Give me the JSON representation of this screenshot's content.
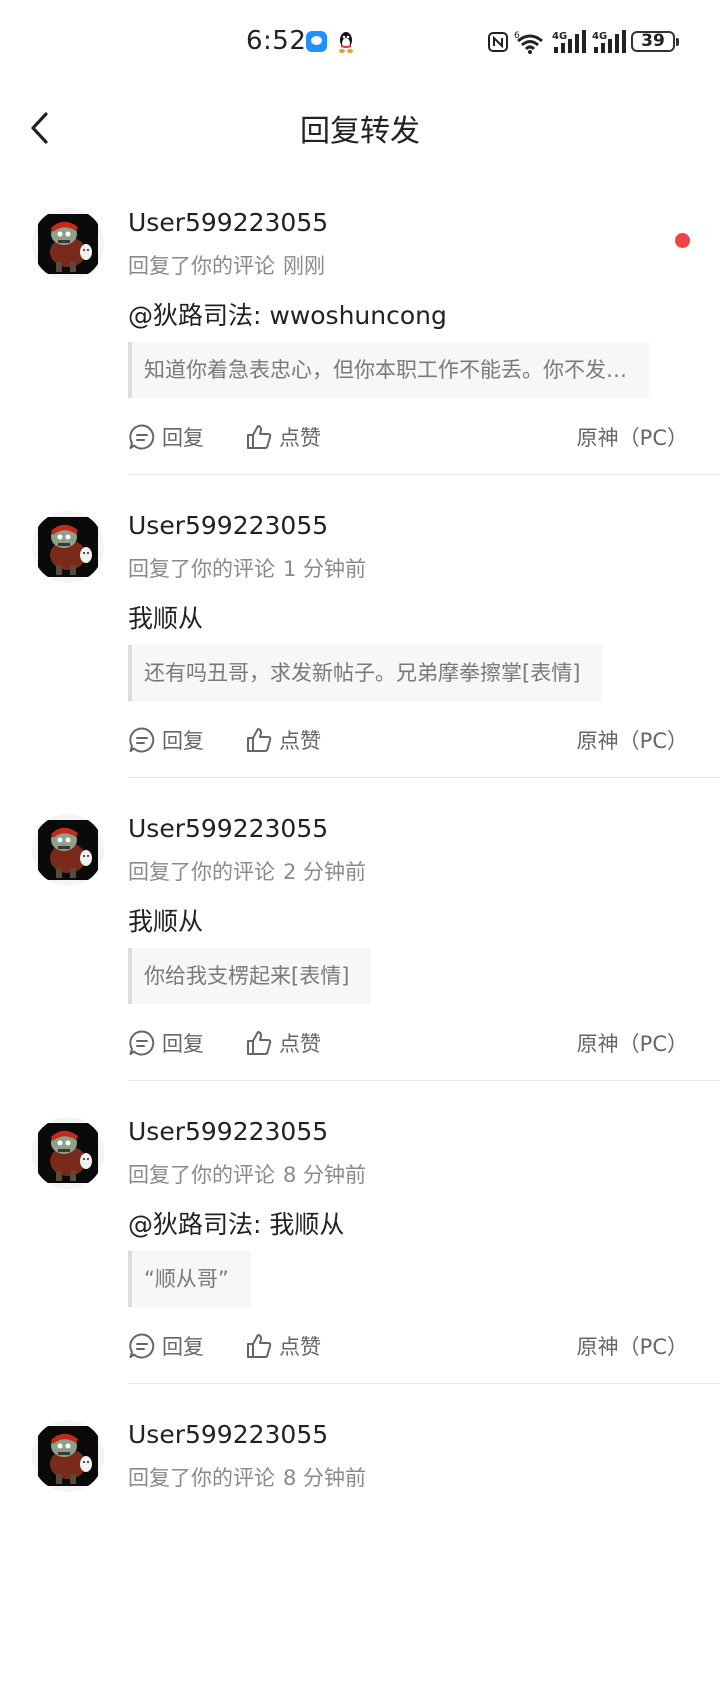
{
  "status_bar": {
    "time": "6:52",
    "battery": "39",
    "icons": [
      "chat-icon",
      "qq-icon",
      "nfc-icon",
      "wifi-icon",
      "signal-4g-icon",
      "signal-4g-icon",
      "battery-icon"
    ]
  },
  "header": {
    "title": "回复转发",
    "back_icon": "chevron-left-icon"
  },
  "colors": {
    "unread_dot": "#ee4444",
    "quote_bg": "#f6f7f8",
    "meta_text": "#8a8a8a"
  },
  "items": [
    {
      "username": "User599223055",
      "action": "回复了你的评论",
      "time": "刚刚",
      "reply": "@狄路司法: wwoshuncong",
      "quote": "知道你着急表忠心，但你本职工作不能丢。你不发…",
      "reply_label": "回复",
      "like_label": "点赞",
      "source": "原神（PC）",
      "unread": true
    },
    {
      "username": "User599223055",
      "action": "回复了你的评论",
      "time": "1 分钟前",
      "reply": "我顺从",
      "quote": "还有吗丑哥，求发新帖子。兄弟摩拳擦掌[表情]",
      "reply_label": "回复",
      "like_label": "点赞",
      "source": "原神（PC）",
      "unread": false
    },
    {
      "username": "User599223055",
      "action": "回复了你的评论",
      "time": "2 分钟前",
      "reply": "我顺从",
      "quote": "你给我支楞起来[表情]",
      "reply_label": "回复",
      "like_label": "点赞",
      "source": "原神（PC）",
      "unread": false
    },
    {
      "username": "User599223055",
      "action": "回复了你的评论",
      "time": "8 分钟前",
      "reply": "@狄路司法: 我顺从",
      "quote": "“顺从哥”",
      "reply_label": "回复",
      "like_label": "点赞",
      "source": "原神（PC）",
      "unread": false
    },
    {
      "username": "User599223055",
      "action": "回复了你的评论",
      "time": "8 分钟前",
      "reply": "",
      "quote": "",
      "reply_label": "",
      "like_label": "",
      "source": "",
      "unread": false
    }
  ]
}
